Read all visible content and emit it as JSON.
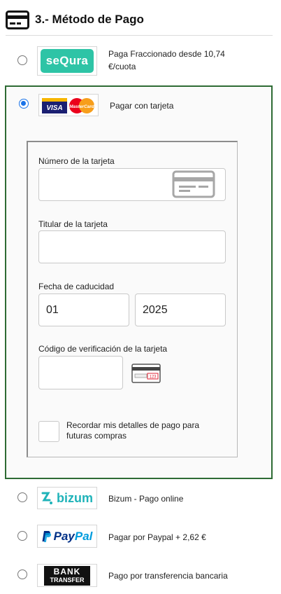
{
  "header": {
    "title": "3.- Método de Pago",
    "icon": "credit-card-icon"
  },
  "options": {
    "sequra": {
      "logo_text": "seQura",
      "label_line1": "Paga Fraccionado desde 10,74",
      "label_line2": "€/cuota",
      "brand_color": "#2ec4a6"
    },
    "card": {
      "visa_text": "VISA",
      "mastercard_text": "MasterCard",
      "label": "Pagar con tarjeta",
      "selected": true,
      "form": {
        "card_number_label": "Número de la tarjeta",
        "card_number_value": "",
        "holder_label": "Titular de la tarjeta",
        "holder_value": "",
        "expiry_label": "Fecha de caducidad",
        "expiry_month": "01",
        "expiry_year": "2025",
        "cvv_label": "Código de verificación de la tarjeta",
        "cvv_value": "",
        "cvv_hint_text": "123",
        "remember_label_line1": "Recordar mis detalles de pago para",
        "remember_label_line2": "futuras compras"
      }
    },
    "bizum": {
      "logo_text": "bizum",
      "label": "Bizum - Pago online",
      "brand_color": "#1fb3b9"
    },
    "paypal": {
      "logo_text_1": "Pay",
      "logo_text_2": "Pal",
      "label": "Pagar por Paypal + 2,62 €"
    },
    "bank": {
      "logo_line1": "BANK",
      "logo_line2": "TRANSFER",
      "label": "Pago por transferencia bancaria"
    }
  },
  "colors": {
    "selected_border": "#2e6b34",
    "radio_checked": "#1a73e8"
  }
}
